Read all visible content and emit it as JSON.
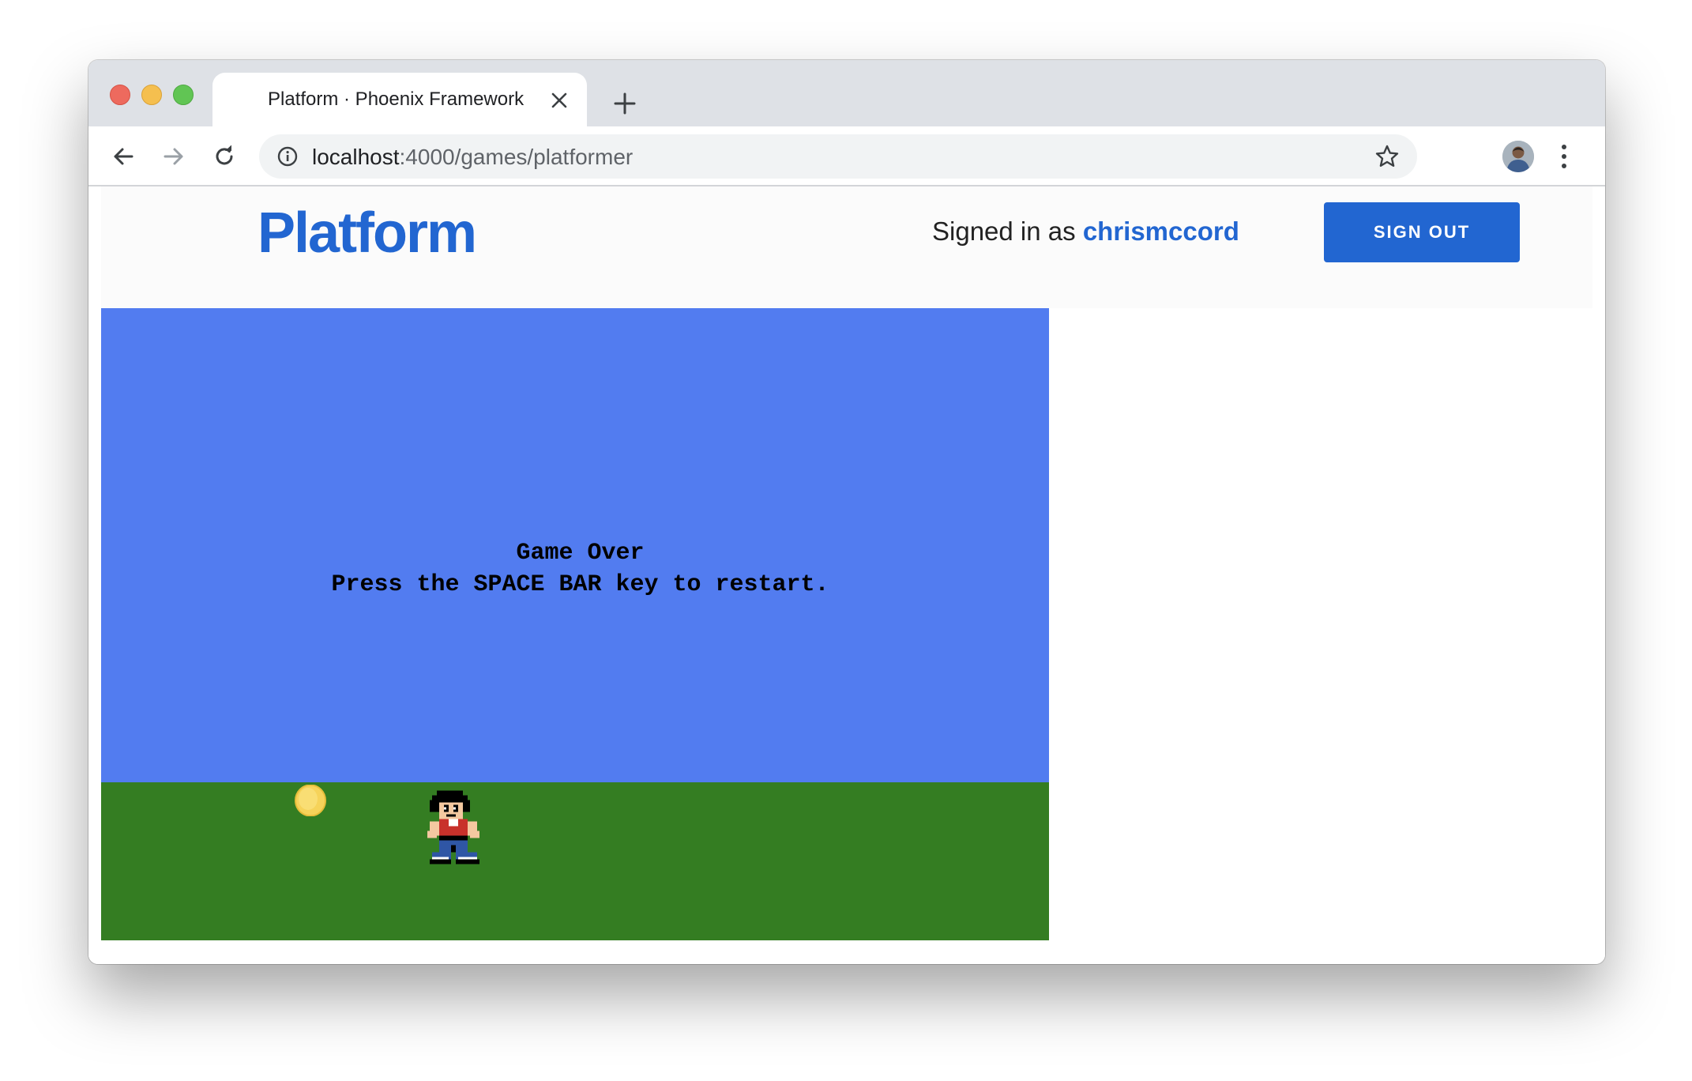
{
  "browser": {
    "tab_title": "Platform · Phoenix Framework",
    "url_host": "localhost",
    "url_path": ":4000/games/platformer",
    "icons": {
      "close": "close-icon",
      "new_tab": "plus-icon",
      "back": "back-arrow-icon",
      "forward": "forward-arrow-icon",
      "reload": "reload-icon",
      "info": "info-icon",
      "bookmark": "star-icon",
      "profile": "avatar",
      "menu": "kebab-menu-icon"
    }
  },
  "header": {
    "logo": "Platform",
    "signed_in_prefix": "Signed in as",
    "username": "chrismccord",
    "sign_out_label": "SIGN OUT"
  },
  "game": {
    "message_line1": "Game Over",
    "message_line2": "Press the SPACE BAR key to restart.",
    "sky_color": "#527cf0",
    "ground_color": "#347d22",
    "coin_color": "#f6d35a"
  },
  "colors": {
    "brand": "#2266d1"
  }
}
